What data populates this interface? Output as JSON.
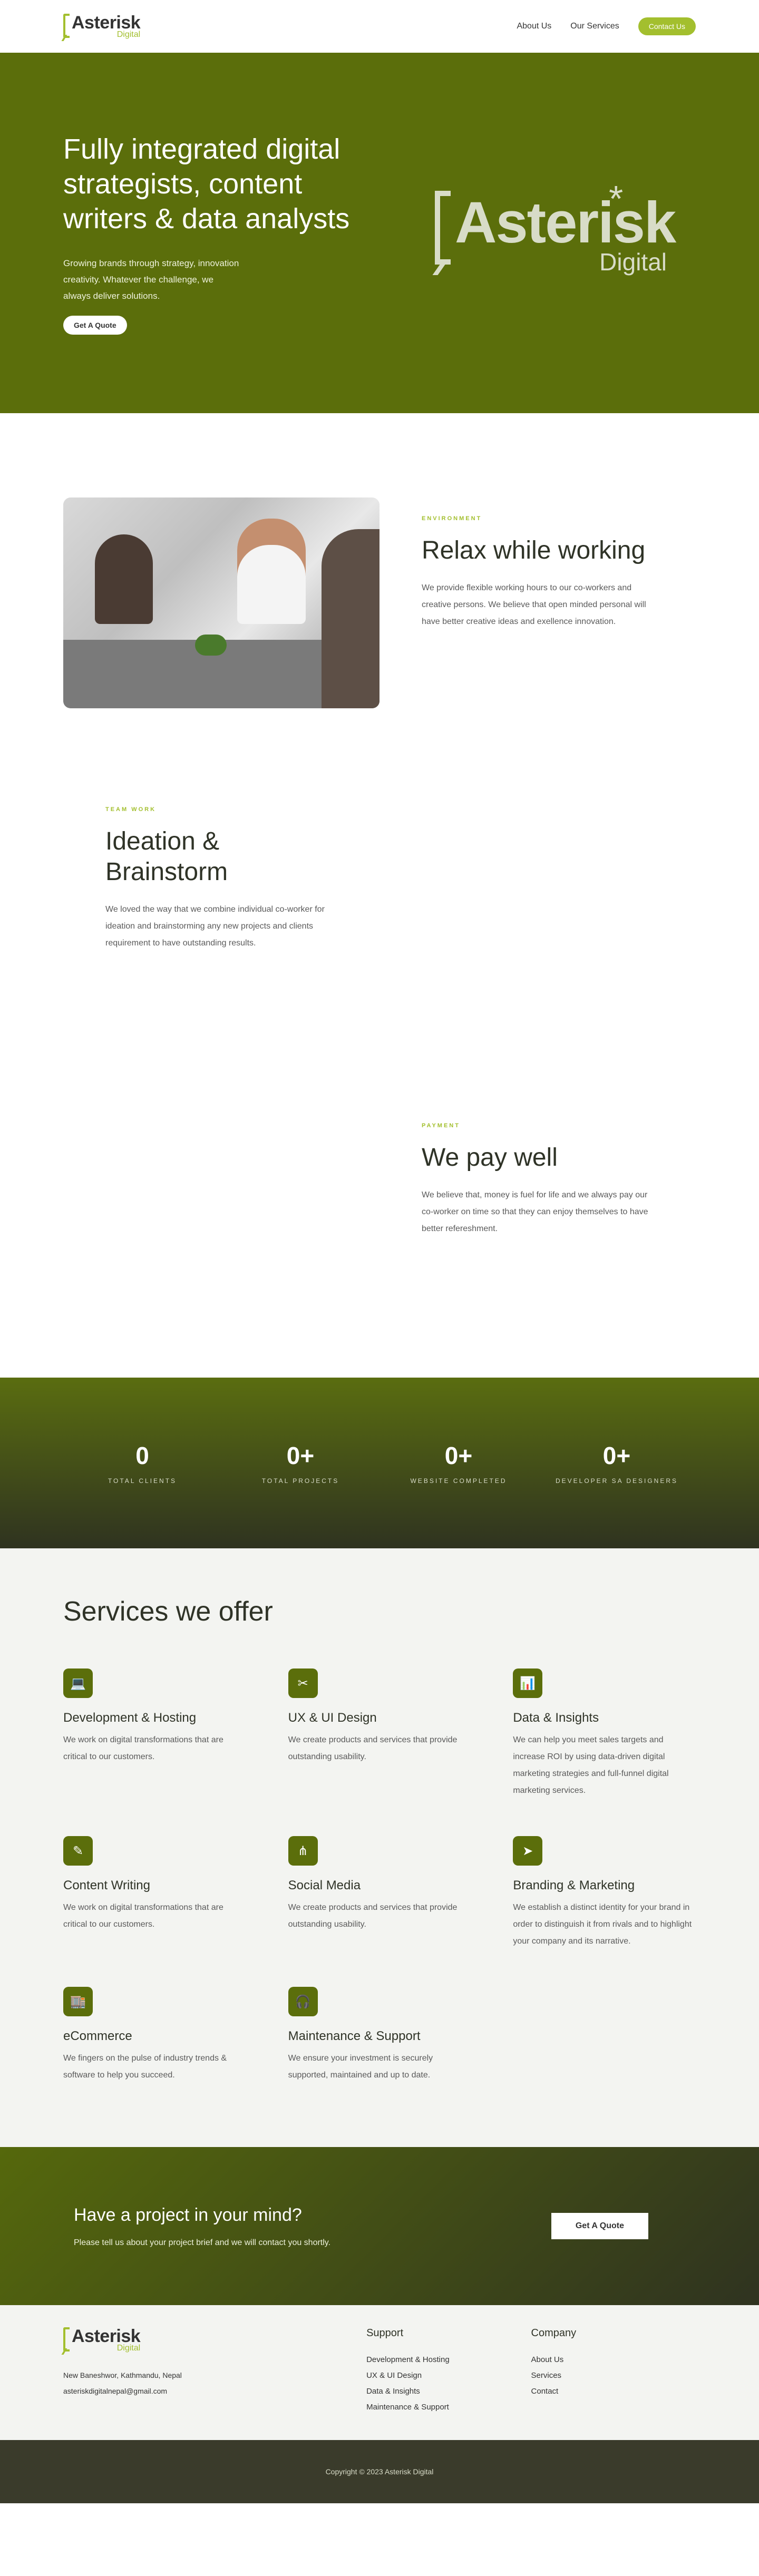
{
  "header": {
    "logo_main": "Asterisk",
    "logo_sub": "Digital",
    "nav": [
      {
        "label": "About Us"
      },
      {
        "label": "Our Services"
      }
    ],
    "contact_label": "Contact Us"
  },
  "hero": {
    "title": "Fully integrated digital strategists, content writers & data analysts",
    "description": "Growing brands through strategy, innovation creativity. Whatever the challenge, we always deliver solutions.",
    "button": "Get A Quote",
    "logo_main": "Asterisk",
    "logo_sub": "Digital"
  },
  "features": [
    {
      "eyebrow": "ENVIRONMENT",
      "title": "Relax while working",
      "description": "We provide flexible working hours to our co-workers and creative persons. We believe that open minded personal will have better creative ideas and exellence innovation."
    },
    {
      "eyebrow": "TEAM WORK",
      "title": "Ideation & Brainstorm",
      "description": "We loved the way that we combine individual co-worker for ideation and brainstorming any new projects and clients requirement to have outstanding results."
    },
    {
      "eyebrow": "PAYMENT",
      "title": "We pay well",
      "description": "We believe that, money is fuel for life and we always pay our co-worker on time so that they can enjoy themselves to have better refereshment."
    }
  ],
  "stats": [
    {
      "number": "0",
      "label": "TOTAL CLIENTS"
    },
    {
      "number": "0+",
      "label": "TOTAL PROJECTS"
    },
    {
      "number": "0+",
      "label": "WEBSITE COMPLETED"
    },
    {
      "number": "0+",
      "label": "DEVELOPER SA DESIGNERS"
    }
  ],
  "services": {
    "title": "Services we offer",
    "items": [
      {
        "icon": "laptop-icon",
        "glyph": "💻",
        "title": "Development & Hosting",
        "description": "We work on digital transformations that are critical to our customers."
      },
      {
        "icon": "design-tools-icon",
        "glyph": "✂",
        "title": "UX & UI Design",
        "description": "We create products and services that provide outstanding usability."
      },
      {
        "icon": "chart-icon",
        "glyph": "📊",
        "title": "Data & Insights",
        "description": "We can help you meet sales targets and increase ROI by using data-driven digital marketing strategies and full-funnel digital marketing services."
      },
      {
        "icon": "text-icon",
        "glyph": "✎",
        "title": "Content Writing",
        "description": "We work on digital transformations that are critical to our customers."
      },
      {
        "icon": "share-icon",
        "glyph": "⋔",
        "title": "Social Media",
        "description": "We create products and services that provide outstanding usability."
      },
      {
        "icon": "send-icon",
        "glyph": "➤",
        "title": "Branding & Marketing",
        "description": "We establish a distinct identity for your brand in order to distinguish it from rivals and to highlight your company and its narrative."
      },
      {
        "icon": "store-icon",
        "glyph": "🏬",
        "title": "eCommerce",
        "description": "We fingers on the pulse of industry trends & software to help you succeed."
      },
      {
        "icon": "headphones-icon",
        "glyph": "🎧",
        "title": "Maintenance & Support",
        "description": "We ensure your investment is securely supported, maintained and up to date."
      }
    ]
  },
  "cta": {
    "title": "Have a project in your mind?",
    "description": "Please tell us about your project brief and we will contact you shortly.",
    "button": "Get A Quote"
  },
  "footer": {
    "logo_main": "Asterisk",
    "logo_sub": "Digital",
    "address": "New Baneshwor, Kathmandu, Nepal",
    "email": "asteriskdigitalnepal@gmail.com",
    "support_title": "Support",
    "support_links": [
      "Development & Hosting",
      "UX & UI Design",
      "Data & Insights",
      "Maintenance & Support"
    ],
    "company_title": "Company",
    "company_links": [
      "About Us",
      "Services",
      "Contact"
    ],
    "copyright": "Copyright © 2023 Asterisk Digital"
  },
  "colors": {
    "accent": "#a3bf2e",
    "brand_dark": "#5b6e0b"
  }
}
